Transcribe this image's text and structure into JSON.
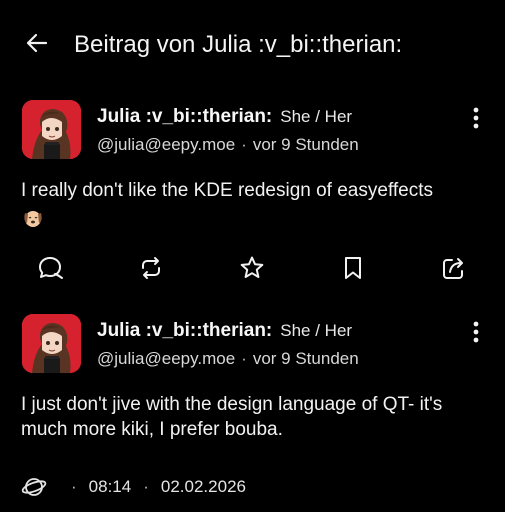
{
  "header": {
    "back_icon": "arrow-left-icon",
    "title": "Beitrag von Julia :v_bi::therian:"
  },
  "posts": [
    {
      "author": {
        "display_name": "Julia :v_bi::therian:",
        "pronouns": "She / Her",
        "handle": "@julia@eepy.moe",
        "separator": "·",
        "time_ago": "vor 9 Stunden"
      },
      "content": "I really don't like the KDE redesign of easyeffects",
      "emoji": "sad-dog-emoji",
      "actions": [
        {
          "icon": "reply-icon"
        },
        {
          "icon": "boost-icon"
        },
        {
          "icon": "favourite-icon"
        },
        {
          "icon": "bookmark-icon"
        },
        {
          "icon": "share-icon"
        }
      ]
    },
    {
      "author": {
        "display_name": "Julia :v_bi::therian:",
        "pronouns": "She / Her",
        "handle": "@julia@eepy.moe",
        "separator": "·",
        "time_ago": "vor 9 Stunden"
      },
      "content": "I just don't jive with the design language of QT- it's much more kiki, I prefer bouba.",
      "meta": {
        "visibility_icon": "globe-icon",
        "dot1": "·",
        "time": "08:14",
        "dot2": "·",
        "date": "02.02.2026"
      }
    }
  ],
  "colors": {
    "background": "#000000",
    "text": "#f2f2f2",
    "avatar_bg": "#d6222f"
  }
}
